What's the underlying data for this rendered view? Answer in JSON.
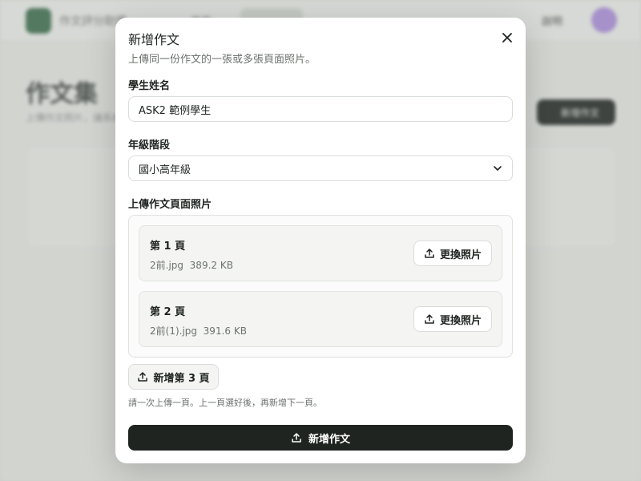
{
  "background": {
    "app_name": "作文評分助理",
    "nav_item": "首頁",
    "right_link": "說明",
    "page_title": "作文集",
    "page_subtitle": "上傳作文照片，讓系統協助評分",
    "new_button": "新增作文"
  },
  "modal": {
    "title": "新增作文",
    "subtitle": "上傳同一份作文的一張或多張頁面照片。",
    "student_name_label": "學生姓名",
    "student_name_value": "ASK2 範例學生",
    "grade_label": "年級階段",
    "grade_value": "國小高年級",
    "upload_label": "上傳作文頁面照片",
    "pages": [
      {
        "label": "第 1 頁",
        "filename": "2前.jpg",
        "size": "389.2 KB",
        "button": "更換照片"
      },
      {
        "label": "第 2 頁",
        "filename": "2前(1).jpg",
        "size": "391.6 KB",
        "button": "更換照片"
      }
    ],
    "add_page_label": "新增第 3 頁",
    "hint": "請一次上傳一頁。上一頁選好後，再新增下一頁。",
    "submit_label": "新增作文"
  },
  "icons": {
    "close": "close-icon",
    "chevron": "chevron-down-icon",
    "upload": "upload-icon"
  }
}
